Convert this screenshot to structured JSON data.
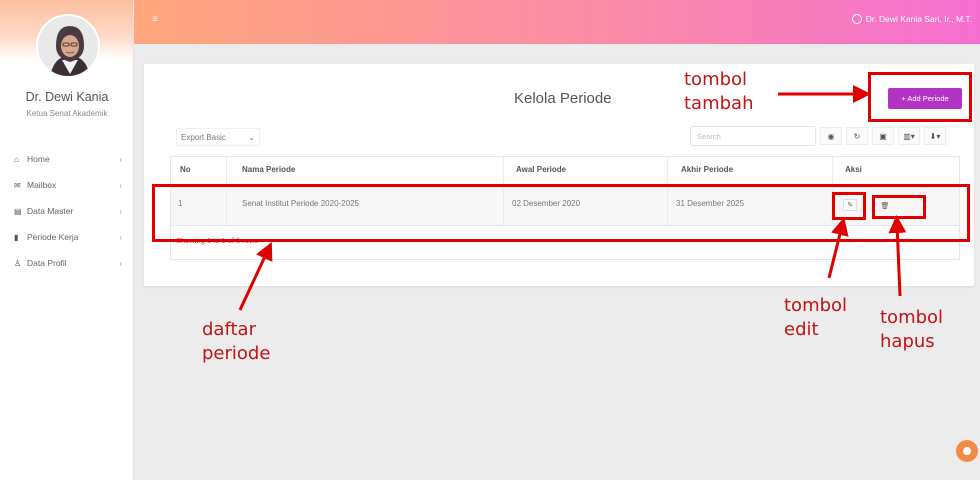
{
  "sidebar": {
    "user_name": "Dr. Dewi Kania",
    "user_role": "Ketua Senat Akademik",
    "items": [
      {
        "label": "Home",
        "icon": "home-icon",
        "glyph": "⌂"
      },
      {
        "label": "Mailbox",
        "icon": "mail-icon",
        "glyph": "✉"
      },
      {
        "label": "Data Master",
        "icon": "database-icon",
        "glyph": "▤"
      },
      {
        "label": "Periode Kerja",
        "icon": "bar-chart-icon",
        "glyph": "▮"
      },
      {
        "label": "Data Profil",
        "icon": "user-icon",
        "glyph": "♙"
      }
    ]
  },
  "topbar": {
    "menu_glyph": "≡",
    "user_label": "Dr. Dewi Kania Sari, Ir., M.T."
  },
  "card": {
    "title": "Kelola Periode",
    "add_button": "+ Add Periode",
    "export_label": "Export Basic",
    "search_placeholder": "Search"
  },
  "table": {
    "headers": [
      "No",
      "Nama Periode",
      "Awal Periode",
      "Akhir Periode",
      "Aksi"
    ],
    "rows": [
      {
        "no": "1",
        "nama": "Senat Institut Periode 2020-2025",
        "awal": "02 Desember 2020",
        "akhir": "31 Desember 2025"
      }
    ],
    "footer": "Showing 1 to 1 of 1 rows"
  },
  "annotations": {
    "tambah": "tombol\ntambah",
    "daftar": "daftar\nperiode",
    "edit": "tombol\nedit",
    "hapus": "tombol\nhapus"
  },
  "colors": {
    "annotation": "#e00000",
    "add_button": "#b334c4"
  }
}
